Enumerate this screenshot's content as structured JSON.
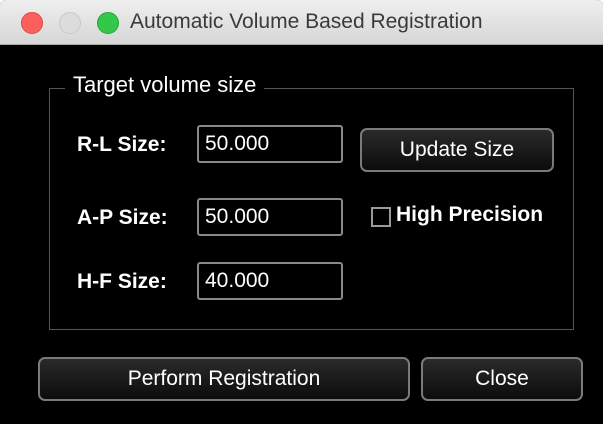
{
  "window": {
    "title": "Automatic Volume Based Registration",
    "traffic_lights": [
      "close-icon",
      "minimize-icon",
      "zoom-icon"
    ]
  },
  "target_group": {
    "legend": "Target volume size",
    "fields": [
      {
        "label": "R-L Size:",
        "value": "50.000"
      },
      {
        "label": "A-P Size:",
        "value": "50.000"
      },
      {
        "label": "H-F Size:",
        "value": "40.000"
      }
    ],
    "update_button": "Update Size",
    "high_precision": {
      "label": "High Precision",
      "checked": false
    }
  },
  "actions": {
    "perform": "Perform Registration",
    "close": "Close"
  },
  "colors": {
    "background": "#000000",
    "close_light": "#fc605c",
    "zoom_light": "#34c84a"
  }
}
